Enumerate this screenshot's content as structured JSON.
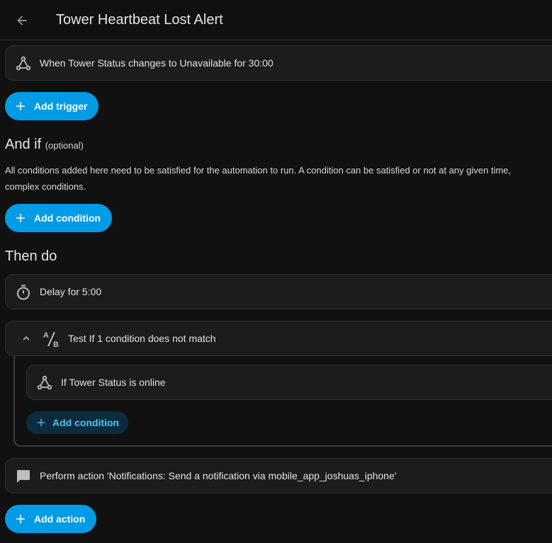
{
  "header": {
    "title": "Tower Heartbeat Lost Alert"
  },
  "triggers": {
    "items": [
      {
        "label": "When Tower Status changes to Unavailable for 30:00",
        "icon": "trigger-node-icon"
      }
    ],
    "add_label": "Add trigger"
  },
  "conditions": {
    "heading": "And if",
    "heading_note": "(optional)",
    "description_line1": "All conditions added here need to be satisfied for the automation to run. A condition can be satisfied or not at any given time,",
    "description_line2": "complex conditions.",
    "add_label": "Add condition"
  },
  "actions": {
    "heading": "Then do",
    "delay_label": "Delay for 5:00",
    "test_label": "Test If 1 condition does not match",
    "nested_condition_label": "If Tower Status is online",
    "nested_add_label": "Add condition",
    "perform_label": "Perform action 'Notifications: Send a notification via mobile_app_joshuas_iphone'",
    "add_label": "Add action"
  },
  "colors": {
    "accent": "#039be5",
    "background": "#111111",
    "card": "#1c1c1c",
    "nested_accent": "#4fc3f7"
  }
}
